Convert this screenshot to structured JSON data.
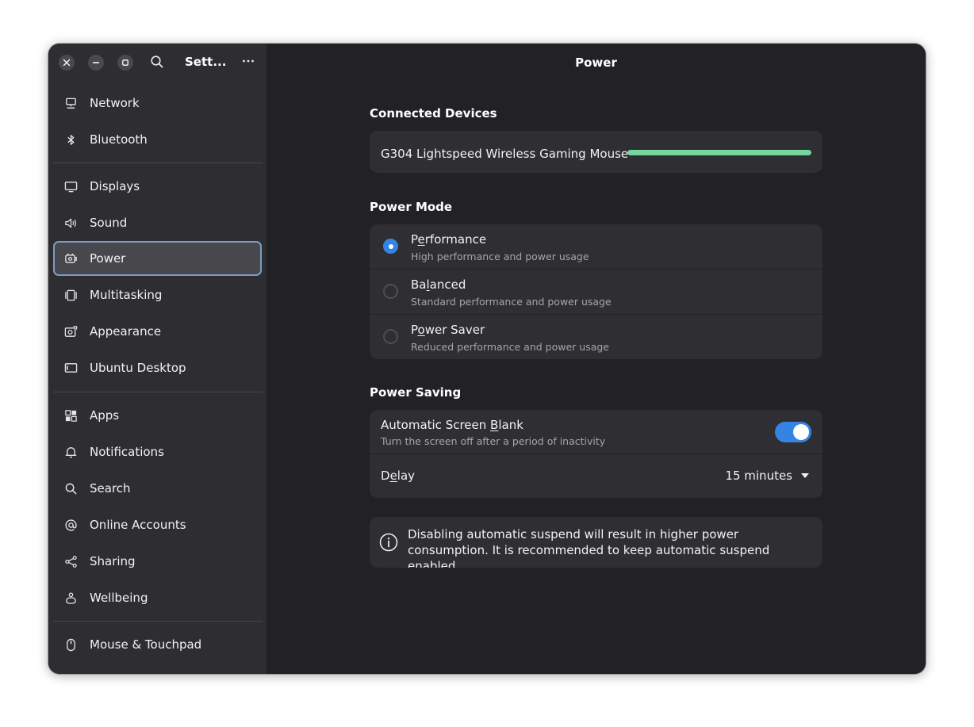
{
  "window": {
    "sidebar_title": "Sett...",
    "page_title": "Power"
  },
  "sidebar": {
    "items": [
      {
        "label": "Network",
        "icon": "network-icon"
      },
      {
        "label": "Bluetooth",
        "icon": "bluetooth-icon"
      },
      {
        "label": "Displays",
        "icon": "display-icon"
      },
      {
        "label": "Sound",
        "icon": "speaker-icon"
      },
      {
        "label": "Power",
        "icon": "power-icon",
        "active": true
      },
      {
        "label": "Multitasking",
        "icon": "multitasking-icon"
      },
      {
        "label": "Appearance",
        "icon": "appearance-icon"
      },
      {
        "label": "Ubuntu Desktop",
        "icon": "ubuntu-desktop-icon"
      },
      {
        "label": "Apps",
        "icon": "apps-icon"
      },
      {
        "label": "Notifications",
        "icon": "bell-icon"
      },
      {
        "label": "Search",
        "icon": "search-icon"
      },
      {
        "label": "Online Accounts",
        "icon": "at-sign-icon"
      },
      {
        "label": "Sharing",
        "icon": "share-icon"
      },
      {
        "label": "Wellbeing",
        "icon": "wellbeing-icon"
      },
      {
        "label": "Mouse & Touchpad",
        "icon": "mouse-icon"
      }
    ]
  },
  "connected_devices": {
    "heading": "Connected Devices",
    "device_name": "G304 Lightspeed Wireless Gaming Mouse",
    "battery_level": 1.0,
    "battery_color": "#77d5a0"
  },
  "power_mode": {
    "heading": "Power Mode",
    "options": [
      {
        "t0": "P",
        "t1": "e",
        "t2": "rformance",
        "subtitle": "High performance and power usage",
        "selected": true
      },
      {
        "t0": "Ba",
        "t1": "l",
        "t2": "anced",
        "subtitle": "Standard performance and power usage",
        "selected": false
      },
      {
        "t0": "P",
        "t1": "o",
        "t2": "wer Saver",
        "subtitle": "Reduced performance and power usage",
        "selected": false
      }
    ]
  },
  "power_saving": {
    "heading": "Power Saving",
    "screen_blank": {
      "t0": "Automatic Screen ",
      "t1": "B",
      "t2": "lank",
      "subtitle": "Turn the screen off after a period of inactivity",
      "enabled": true
    },
    "delay": {
      "t0": "D",
      "t1": "e",
      "t2": "lay",
      "value": "15 minutes"
    }
  },
  "info_banner": {
    "text": "Disabling automatic suspend will result in higher power consumption. It is recommended to keep automatic suspend enabled."
  },
  "colors": {
    "accent": "#3584e4",
    "sidebar_bg": "#2e2e32",
    "content_bg": "#222226",
    "card_bg": "#2f2f33"
  }
}
